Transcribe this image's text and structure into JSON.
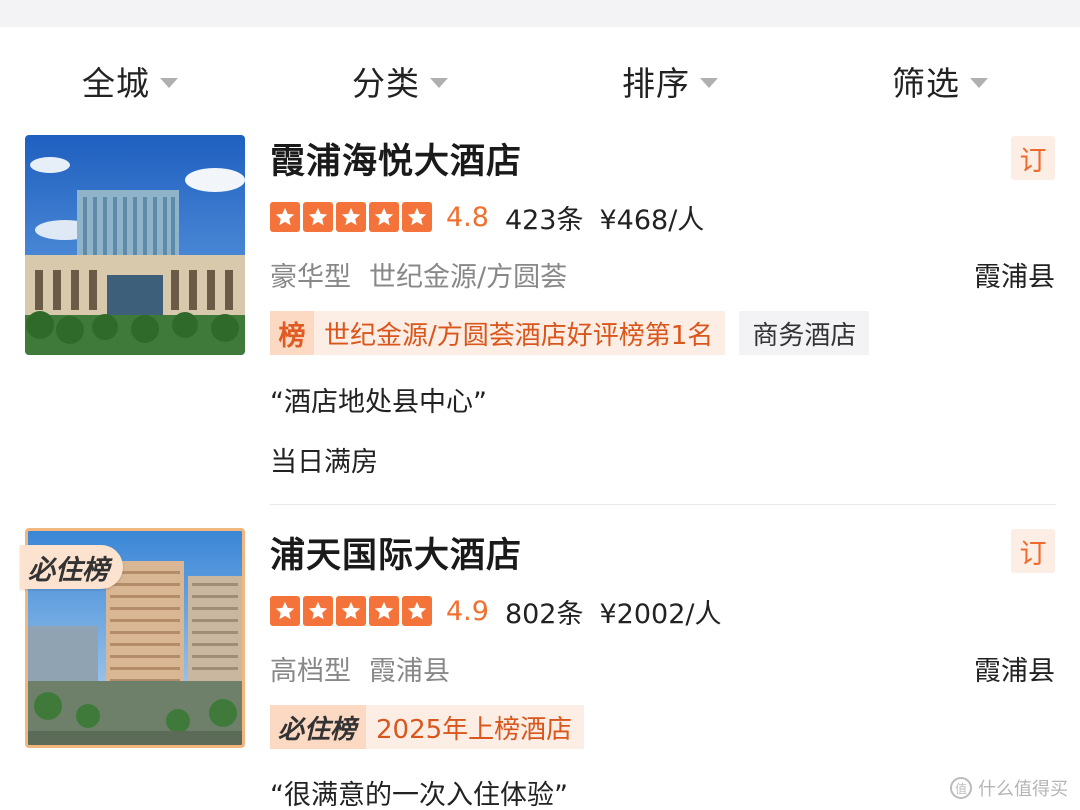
{
  "filters": [
    {
      "label": "全城"
    },
    {
      "label": "分类"
    },
    {
      "label": "排序"
    },
    {
      "label": "筛选"
    }
  ],
  "hotels": [
    {
      "name": "霞浦海悦大酒店",
      "book": "订",
      "score": "4.8",
      "count": "423条",
      "price": "¥468/人",
      "star_count": 5,
      "type": "豪华型",
      "area": "世纪金源/方圆荟",
      "district": "霞浦县",
      "rank_icon": "榜",
      "rank_text": "世纪金源/方圆荟酒店好评榜第1名",
      "category": "商务酒店",
      "review": "“酒店地处县中心”",
      "availability": "当日满房"
    },
    {
      "name": "浦天国际大酒店",
      "book": "订",
      "score": "4.9",
      "count": "802条",
      "price": "¥2002/人",
      "star_count": 5,
      "type": "高档型",
      "area": "霞浦县",
      "district": "霞浦县",
      "thumb_badge": "必住榜",
      "rank_icon": "必住榜",
      "rank_text": "2025年上榜酒店",
      "review": "“很满意的一次入住体验”"
    }
  ],
  "watermark": "什么值得买",
  "colors": {
    "accent": "#f4733a",
    "rank_bg": "#fdeee5",
    "tag_bg": "#f3f3f5"
  }
}
